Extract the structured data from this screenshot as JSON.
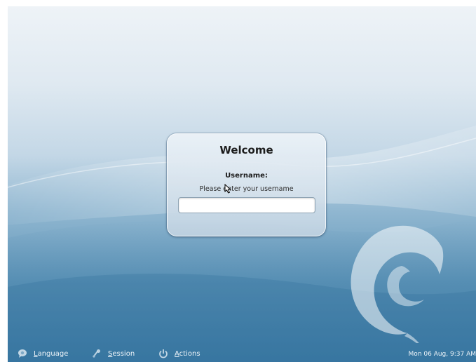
{
  "login": {
    "title": "Welcome",
    "field_label": "Username:",
    "hint": "Please enter your username",
    "username_value": ""
  },
  "panel": {
    "items": [
      {
        "label": "Language",
        "icon": "speech-bubble-icon"
      },
      {
        "label": "Session",
        "icon": "session-icon"
      },
      {
        "label": "Actions",
        "icon": "power-icon"
      }
    ],
    "clock": "Mon 06 Aug,  9:37 AM"
  },
  "theme": {
    "background_light": "#eef3f7",
    "background_dark": "#4b86ad",
    "swirl_color": "#ffffff"
  }
}
